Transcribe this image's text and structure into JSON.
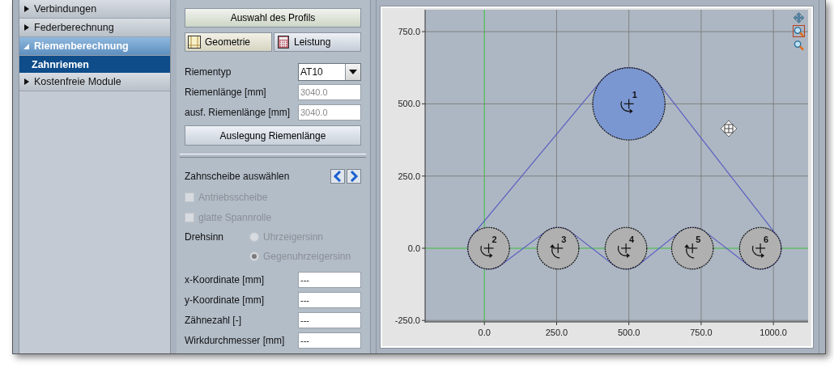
{
  "sidebar": {
    "items": [
      {
        "label": "Verbindungen",
        "expanded": false
      },
      {
        "label": "Federberechnung",
        "expanded": false
      },
      {
        "label": "Riemenberechnung",
        "expanded": true,
        "children": [
          {
            "label": "Zahnriemen",
            "selected": true
          }
        ]
      },
      {
        "label": "Kostenfreie Module",
        "expanded": false
      }
    ]
  },
  "form": {
    "profile_button": "Auswahl des Profils",
    "tabs": [
      {
        "label": "Geometrie",
        "selected": true,
        "kind": "geometry"
      },
      {
        "label": "Leistung",
        "selected": false,
        "kind": "calculator"
      }
    ],
    "belt_type": {
      "label": "Riementyp",
      "value": "AT10"
    },
    "belt_fields": [
      {
        "label": "Riemenlänge [mm]",
        "value": "3040.0",
        "disabled": true
      },
      {
        "label": "ausf. Riemenlänge [mm]",
        "value": "3040.0",
        "disabled": true
      }
    ],
    "design_button": "Auslegung Riemenlänge",
    "pulley_select": {
      "label": "Zahnscheibe auswählen"
    },
    "checkboxes": [
      {
        "label": "Antriebsscheibe",
        "checked": false,
        "disabled": true
      },
      {
        "label": "glatte Spannrolle",
        "checked": false,
        "disabled": true
      }
    ],
    "rotation": {
      "label": "Drehsinn",
      "options": [
        {
          "label": "Uhrzeigersinn",
          "selected": false,
          "disabled": true
        },
        {
          "label": "Gegenuhrzeigersinn",
          "selected": true,
          "disabled": true
        }
      ]
    },
    "fields": [
      {
        "label": "x-Koordinate [mm]",
        "value": "---"
      },
      {
        "label": "y-Koordinate [mm]",
        "value": "---"
      },
      {
        "label": "Zähnezahl [-]",
        "value": "---"
      },
      {
        "label": "Wirkdurchmesser [mm]",
        "value": "---"
      }
    ]
  },
  "chart": {
    "tools": [
      {
        "kind": "pan",
        "selected": false
      },
      {
        "kind": "zoom-box",
        "selected": true
      },
      {
        "kind": "zoom",
        "selected": false
      }
    ],
    "pulleys": [
      {
        "label": "1",
        "kind": "large",
        "clockwise": false,
        "selected": true
      },
      {
        "label": "2",
        "kind": "small",
        "clockwise": false,
        "selected": false
      },
      {
        "label": "3",
        "kind": "small",
        "clockwise": true,
        "selected": false
      },
      {
        "label": "4",
        "kind": "small",
        "clockwise": false,
        "selected": false
      },
      {
        "label": "5",
        "kind": "small",
        "clockwise": true,
        "selected": false
      },
      {
        "label": "6",
        "kind": "small",
        "clockwise": false,
        "selected": false
      }
    ],
    "chart_data": {
      "type": "scatter",
      "grid": true,
      "x": [
        500,
        15,
        255,
        490,
        720,
        955
      ],
      "series": [
        {
          "values": [
            500,
            0,
            0,
            0,
            0,
            0
          ]
        }
      ],
      "xlim": [
        -205,
        1120
      ],
      "ylim": [
        -255,
        826
      ],
      "xticks": [
        {
          "value": 0,
          "label": "0.0"
        },
        {
          "value": 250,
          "label": "250.0"
        },
        {
          "value": 500,
          "label": "500.0"
        },
        {
          "value": 750,
          "label": "750.0"
        },
        {
          "value": 1000,
          "label": "1000.0"
        }
      ],
      "yticks": [
        {
          "value": -250,
          "label": "-250.0"
        },
        {
          "value": 0,
          "label": "0.0"
        },
        {
          "value": 250,
          "label": "250.0"
        },
        {
          "value": 500,
          "label": "500.0"
        },
        {
          "value": 750,
          "label": "750.0"
        }
      ]
    }
  }
}
